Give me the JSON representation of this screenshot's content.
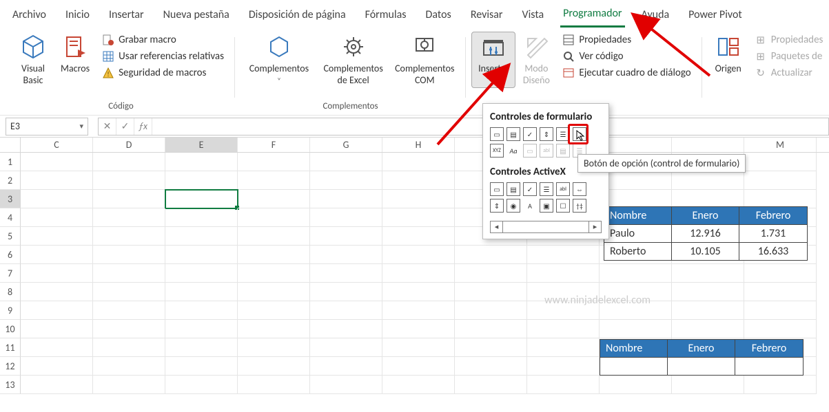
{
  "tabs": {
    "archivo": "Archivo",
    "inicio": "Inicio",
    "insertar": "Insertar",
    "nueva_pestana": "Nueva pestaña",
    "disposicion": "Disposición de página",
    "formulas": "Fórmulas",
    "datos": "Datos",
    "revisar": "Revisar",
    "vista": "Vista",
    "programador": "Programador",
    "ayuda": "Ayuda",
    "powerpivot": "Power Pivot"
  },
  "ribbon": {
    "codigo": {
      "label": "Código",
      "vb": "Visual\nBasic",
      "macros": "Macros",
      "grabar": "Grabar macro",
      "refrel": "Usar referencias relativas",
      "seg": "Seguridad de macros"
    },
    "complementos": {
      "label": "Complementos",
      "c1": "Complementos",
      "c2": "Complementos\nde Excel",
      "c3": "Complementos\nCOM"
    },
    "controles": {
      "insertar": "Insertar",
      "modo": "Modo\nDiseño",
      "prop": "Propiedades",
      "cod": "Ver código",
      "dialog": "Ejecutar cuadro de diálogo"
    },
    "xml": {
      "origen": "Origen",
      "propmap": "Propiedades",
      "paq": "Paquetes de",
      "act": "Actualizar"
    }
  },
  "popup": {
    "title1": "Controles de formulario",
    "title2": "Controles ActiveX",
    "tooltip": "Botón de opción (control de formulario)"
  },
  "fx": {
    "namebox": "E3",
    "fx": "ƒx"
  },
  "columns": [
    "C",
    "D",
    "E",
    "F",
    "G",
    "H",
    "",
    "",
    "",
    "",
    "M"
  ],
  "rows": [
    "1",
    "2",
    "3",
    "4",
    "5",
    "6",
    "7",
    "8",
    "9",
    "10",
    "11",
    "12",
    "13"
  ],
  "table1": {
    "headers": [
      "Nombre",
      "Enero",
      "Febrero"
    ],
    "rows": [
      [
        "Paulo",
        "12.916",
        "1.731"
      ],
      [
        "Roberto",
        "10.105",
        "16.633"
      ]
    ]
  },
  "table2": {
    "headers": [
      "Nombre",
      "Enero",
      "Febrero"
    ]
  },
  "watermark": "www.ninjadelexcel.com"
}
